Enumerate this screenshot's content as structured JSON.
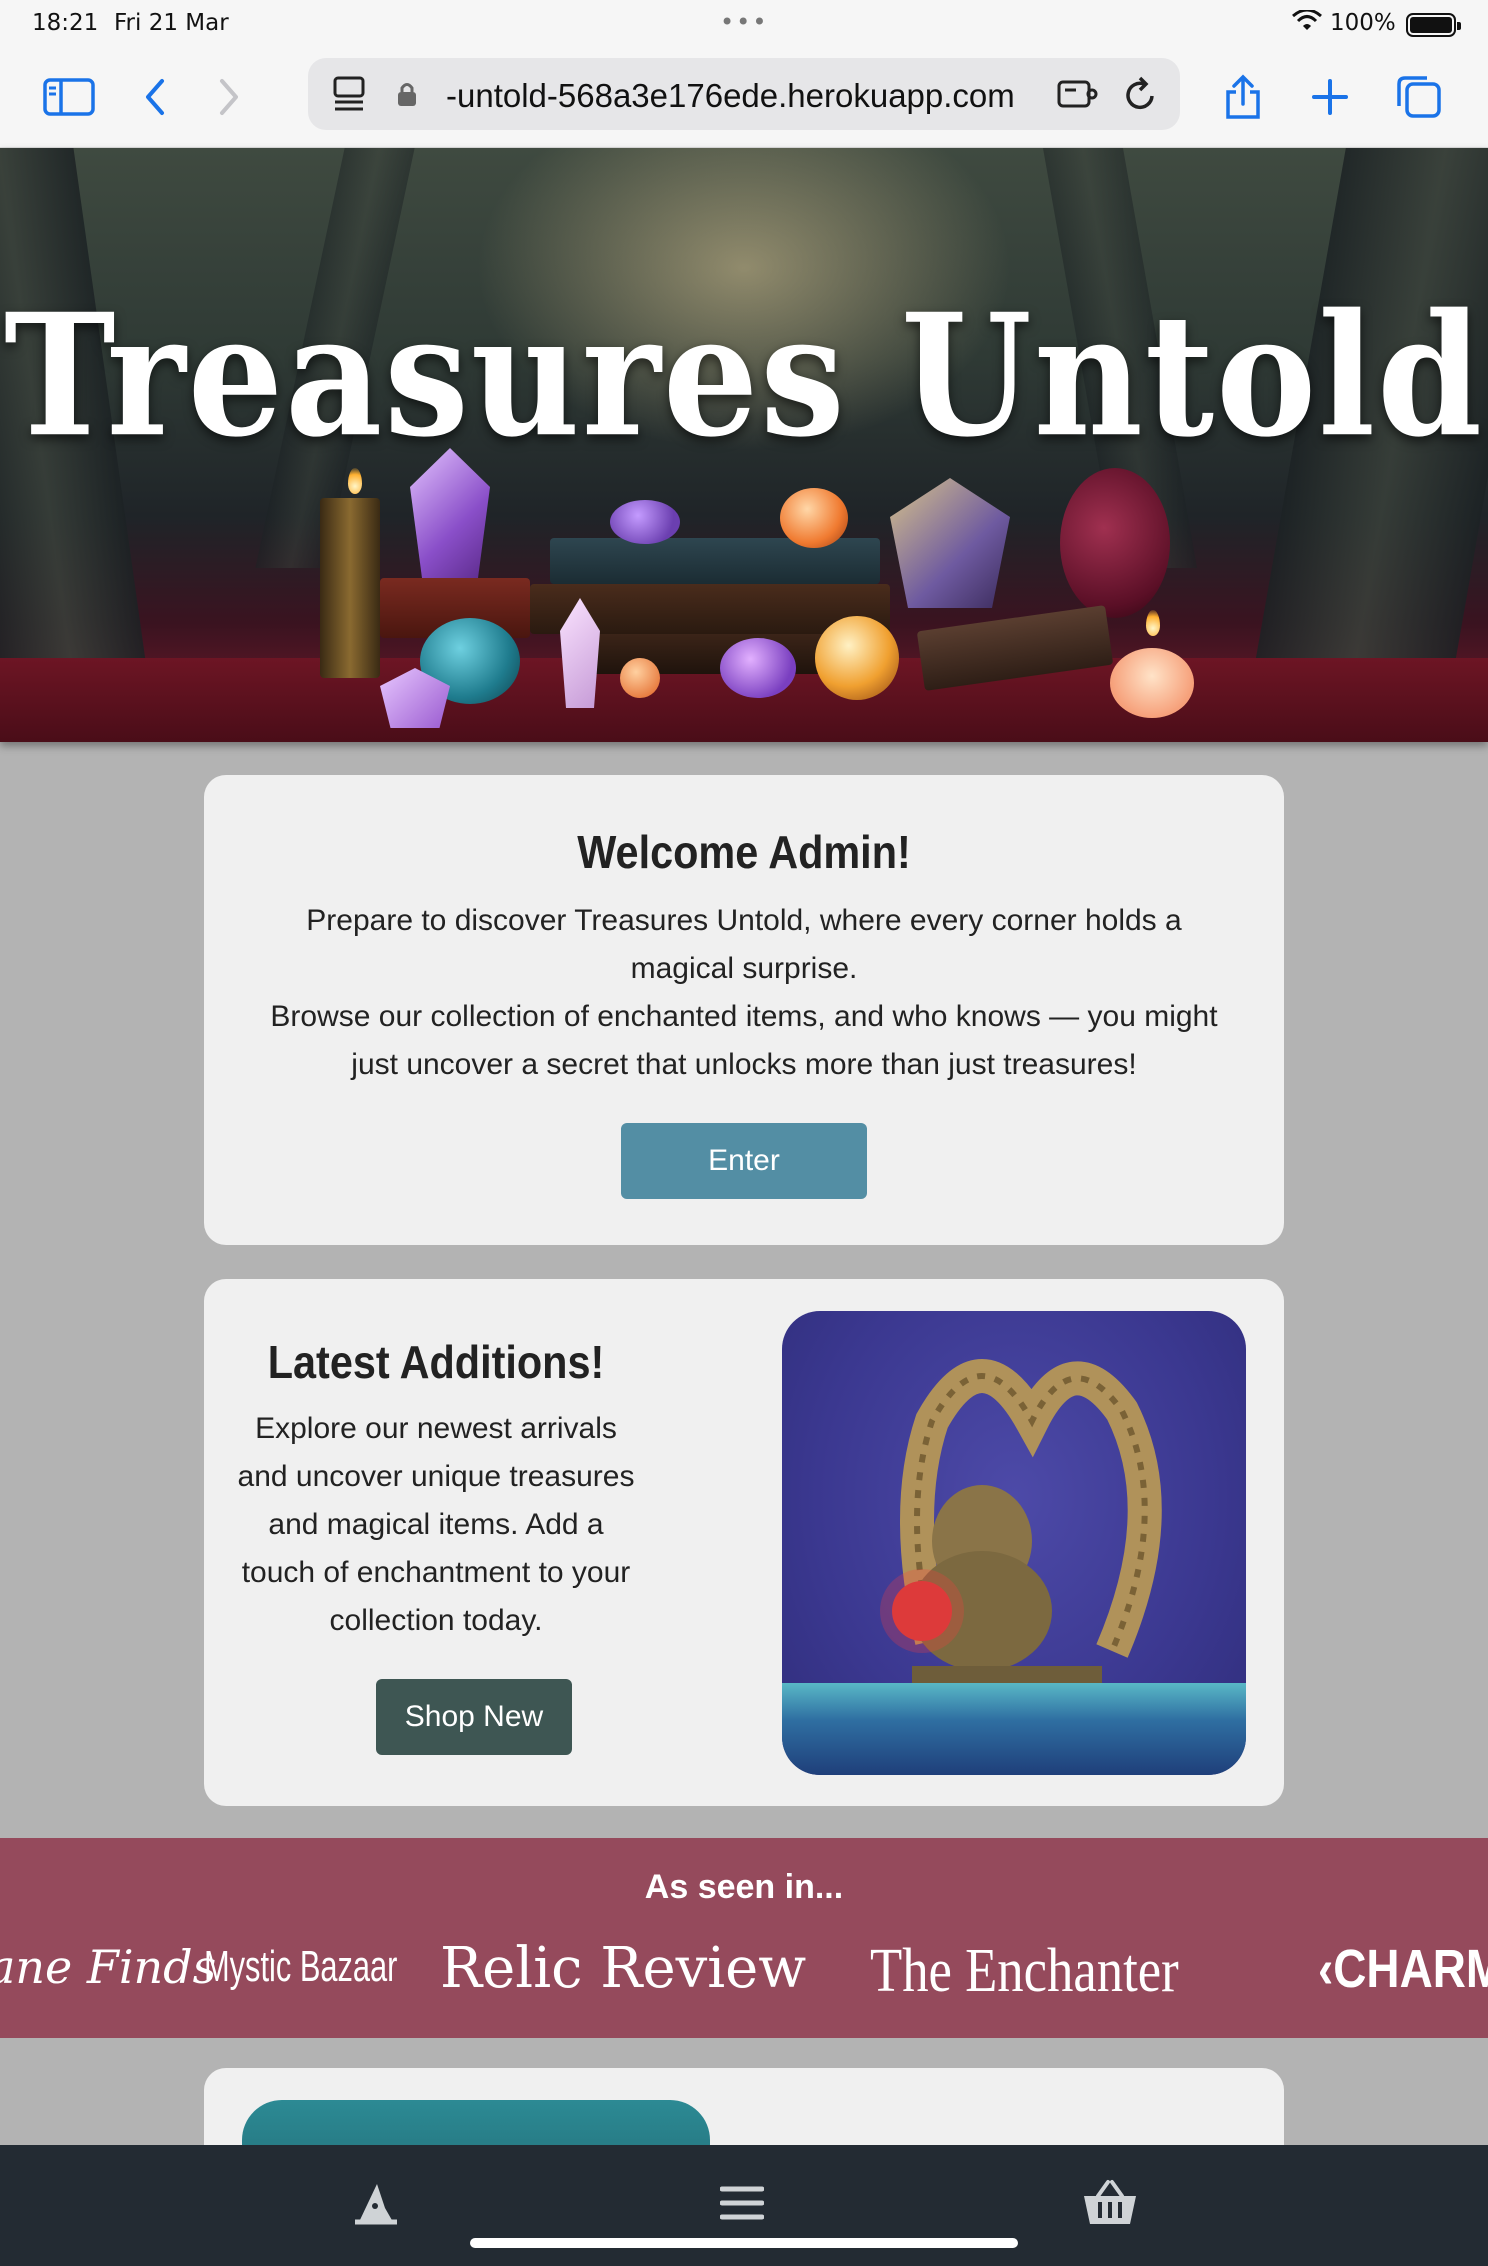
{
  "status_bar": {
    "time": "18:21",
    "date": "Fri 21 Mar",
    "battery_percent": "100%",
    "battery_level": 1.0
  },
  "browser": {
    "url": "-untold-568a3e176ede.herokuapp.com",
    "accent_color": "#1a73e8"
  },
  "hero": {
    "title": "Treasures Untold"
  },
  "welcome_card": {
    "heading": "Welcome Admin!",
    "paragraph_1": "Prepare to discover Treasures Untold, where every corner holds a magical surprise.",
    "paragraph_2": "Browse our collection of enchanted items, and who knows — you might just uncover a secret that unlocks more than just treasures!",
    "button_label": "Enter",
    "button_color": "#538ea4"
  },
  "latest_card": {
    "heading": "Latest Additions!",
    "paragraph": "Explore our newest arrivals and uncover unique treasures and magical items. Add a touch of enchantment to your collection today.",
    "button_label": "Shop New",
    "button_color": "#3e5653"
  },
  "seen_in": {
    "heading": "As seen in...",
    "background_color": "#954a5c",
    "logos": [
      "ane Finds",
      "Mystic Bazaar",
      "Relic Review",
      "The Enchanter",
      "CHARM"
    ]
  },
  "bottom_nav": {
    "items": [
      {
        "icon": "wizard-hat-icon"
      },
      {
        "icon": "menu-icon"
      },
      {
        "icon": "basket-icon"
      }
    ]
  }
}
